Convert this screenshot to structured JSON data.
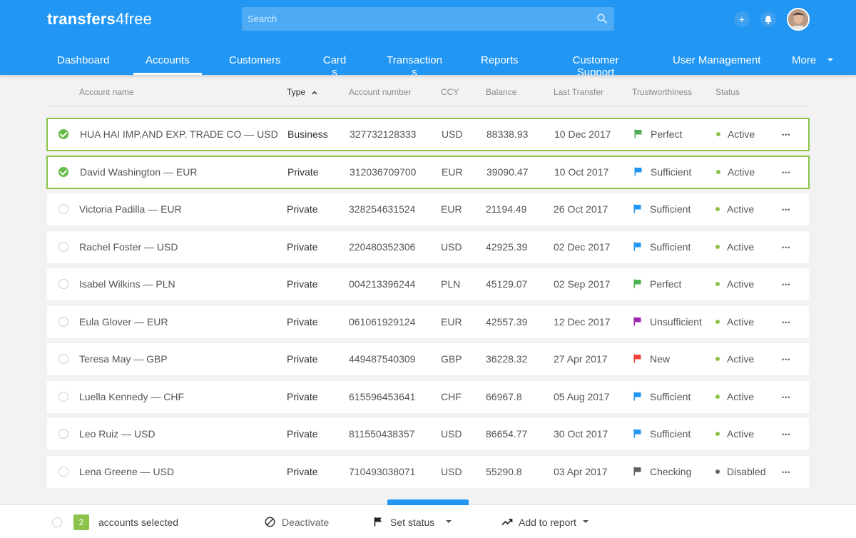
{
  "header": {
    "logo_bold": "transfers",
    "logo_thin": "4free",
    "search_placeholder": "Search",
    "add_label": "+",
    "colors": {
      "header_bg": "#2196f3",
      "search_bg": "#4dabf5"
    }
  },
  "nav": {
    "items": [
      {
        "label": "Dashboard"
      },
      {
        "label": "Accounts",
        "active": true
      },
      {
        "label": "Customers"
      },
      {
        "label": "Cards"
      },
      {
        "label": "Transactions"
      },
      {
        "label": "Reports"
      },
      {
        "label": "Customer Support"
      },
      {
        "label": "User Management"
      },
      {
        "label": "More"
      }
    ]
  },
  "table": {
    "columns": [
      "Account name",
      "Type",
      "Account number",
      "CCY",
      "Balance",
      "Last Transfer",
      "Trustworthiness",
      "Status"
    ],
    "sorted_column": "Type",
    "rows": [
      {
        "selected": true,
        "name": "HUA HAI IMP.AND EXP. TRADE CO — USD",
        "type": "Business",
        "number": "327732128333",
        "ccy": "USD",
        "balance": "88338.93",
        "last": "10 Dec 2017",
        "trust": "Perfect",
        "trust_color": "#4caf50",
        "status": "Active",
        "status_color": "#8bc34a"
      },
      {
        "selected": true,
        "name": "David Washington — EUR",
        "type": "Private",
        "number": "312036709700",
        "ccy": "EUR",
        "balance": "39090.47",
        "last": "10 Oct 2017",
        "trust": "Sufficient",
        "trust_color": "#2196f3",
        "status": "Active",
        "status_color": "#8bc34a"
      },
      {
        "selected": false,
        "name": "Victoria Padilla — EUR",
        "type": "Private",
        "number": "328254631524",
        "ccy": "EUR",
        "balance": "21194.49",
        "last": "26 Oct 2017",
        "trust": "Sufficient",
        "trust_color": "#2196f3",
        "status": "Active",
        "status_color": "#8bc34a"
      },
      {
        "selected": false,
        "name": "Rachel Foster — USD",
        "type": "Private",
        "number": "220480352306",
        "ccy": "USD",
        "balance": "42925.39",
        "last": "02 Dec 2017",
        "trust": "Sufficient",
        "trust_color": "#2196f3",
        "status": "Active",
        "status_color": "#8bc34a"
      },
      {
        "selected": false,
        "name": "Isabel Wilkins — PLN",
        "type": "Private",
        "number": "004213396244",
        "ccy": "PLN",
        "balance": "45129.07",
        "last": "02 Sep 2017",
        "trust": "Perfect",
        "trust_color": "#4caf50",
        "status": "Active",
        "status_color": "#8bc34a"
      },
      {
        "selected": false,
        "name": "Eula Glover — EUR",
        "type": "Private",
        "number": "061061929124",
        "ccy": "EUR",
        "balance": "42557.39",
        "last": "12 Dec 2017",
        "trust": "Unsufficient",
        "trust_color": "#9c27b0",
        "status": "Active",
        "status_color": "#8bc34a"
      },
      {
        "selected": false,
        "name": "Teresa May — GBP",
        "type": "Private",
        "number": "449487540309",
        "ccy": "GBP",
        "balance": "36228.32",
        "last": "27 Apr 2017",
        "trust": "New",
        "trust_color": "#f44336",
        "status": "Active",
        "status_color": "#8bc34a"
      },
      {
        "selected": false,
        "name": "Luella Kennedy — CHF",
        "type": "Private",
        "number": "615596453641",
        "ccy": "CHF",
        "balance": "66967.8",
        "last": "05 Aug 2017",
        "trust": "Sufficient",
        "trust_color": "#2196f3",
        "status": "Active",
        "status_color": "#8bc34a"
      },
      {
        "selected": false,
        "name": "Leo Ruiz — USD",
        "type": "Private",
        "number": "811550438357",
        "ccy": "USD",
        "balance": "86654.77",
        "last": "30 Oct 2017",
        "trust": "Sufficient",
        "trust_color": "#2196f3",
        "status": "Active",
        "status_color": "#8bc34a"
      },
      {
        "selected": false,
        "name": "Lena Greene — USD",
        "type": "Private",
        "number": "710493038071",
        "ccy": "USD",
        "balance": "55290.8",
        "last": "03 Apr 2017",
        "trust": "Checking",
        "trust_color": "#616161",
        "status": "Disabled",
        "status_color": "#616161"
      }
    ]
  },
  "footer": {
    "selected_count": "2",
    "selected_label": "accounts selected",
    "deactivate_label": "Deactivate",
    "set_status_label": "Set status",
    "add_to_report_label": "Add to report"
  }
}
